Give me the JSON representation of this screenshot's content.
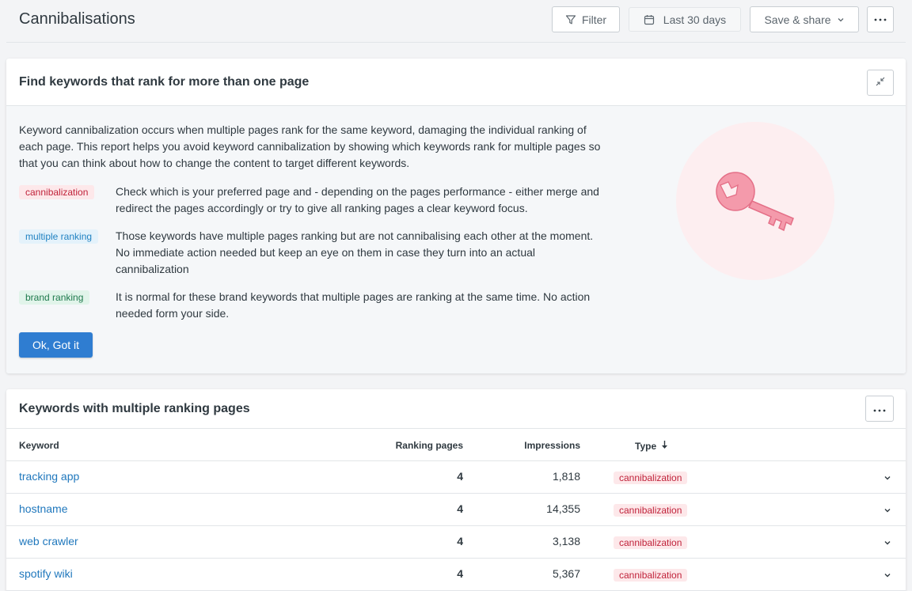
{
  "header": {
    "title": "Cannibalisations",
    "filter_label": "Filter",
    "date_label": "Last 30 days",
    "save_label": "Save & share"
  },
  "info_card": {
    "title": "Find keywords that rank for more than one page",
    "intro": "Keyword cannibalization occurs when multiple pages rank for the same keyword, damaging the individual ranking of each page. This report helps you avoid keyword cannibalization by showing which keywords rank for multiple pages so that you can think about how to change the content to target different keywords.",
    "legend": [
      {
        "tag": "cannibalization",
        "text": "Check which is your preferred page and - depending on the pages performance - either merge and redirect the pages accordingly or try to give all ranking pages a clear keyword focus."
      },
      {
        "tag": "multiple ranking",
        "text": "Those keywords have multiple pages ranking but are not cannibalising each other at the moment. No immediate action needed but keep an eye on them in case they turn into an actual cannibalization"
      },
      {
        "tag": "brand ranking",
        "text": "It is normal for these brand keywords that multiple pages are ranking at the same time. No action needed form your side."
      }
    ],
    "ok_label": "Ok, Got it"
  },
  "table_card": {
    "title": "Keywords with multiple ranking pages",
    "columns": {
      "keyword": "Keyword",
      "ranking_pages": "Ranking pages",
      "impressions": "Impressions",
      "type": "Type"
    },
    "rows": [
      {
        "keyword": "tracking app",
        "ranking_pages": "4",
        "impressions": "1,818",
        "type": "cannibalization"
      },
      {
        "keyword": "hostname",
        "ranking_pages": "4",
        "impressions": "14,355",
        "type": "cannibalization"
      },
      {
        "keyword": "web crawler",
        "ranking_pages": "4",
        "impressions": "3,138",
        "type": "cannibalization"
      },
      {
        "keyword": "spotify wiki",
        "ranking_pages": "4",
        "impressions": "5,367",
        "type": "cannibalization"
      }
    ]
  },
  "colors": {
    "primary": "#2f7dd1",
    "link": "#2078bd",
    "cannibalization_bg": "#fde8ea",
    "cannibalization_fg": "#c0223a",
    "key_illustration": "#f28ba0"
  }
}
